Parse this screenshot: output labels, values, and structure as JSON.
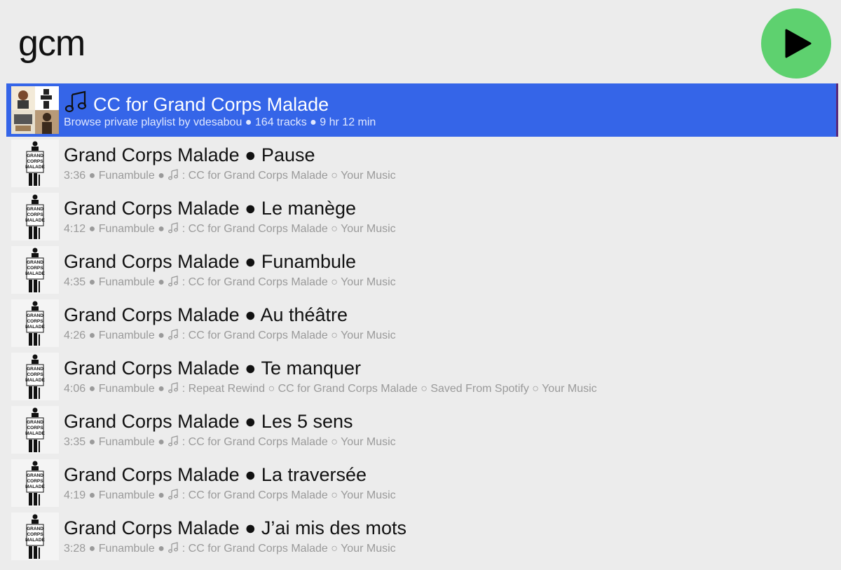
{
  "search": {
    "query": "gcm"
  },
  "controls": {
    "play_icon": "play-icon",
    "play_color": "#5ed16f",
    "selected_color": "#3565e8"
  },
  "results": [
    {
      "selected": true,
      "kind": "playlist",
      "title": "CC for Grand Corps Malade",
      "meta": "Browse private playlist by vdesabou ● 164 tracks ● 9 hr 12 min"
    },
    {
      "title": "Grand Corps Malade ● Pause",
      "meta_before": "3:36 ● Funambule ● ",
      "meta_after": " : CC for Grand Corps Malade ○ Your Music"
    },
    {
      "title": "Grand Corps Malade ● Le manège",
      "meta_before": "4:12 ● Funambule ● ",
      "meta_after": " : CC for Grand Corps Malade ○ Your Music"
    },
    {
      "title": "Grand Corps Malade ● Funambule",
      "meta_before": "4:35 ● Funambule ● ",
      "meta_after": " : CC for Grand Corps Malade ○ Your Music"
    },
    {
      "title": "Grand Corps Malade ● Au théâtre",
      "meta_before": "4:26 ● Funambule ● ",
      "meta_after": " : CC for Grand Corps Malade ○ Your Music"
    },
    {
      "title": "Grand Corps Malade ● Te manquer",
      "meta_before": "4:06 ● Funambule ● ",
      "meta_after": " : Repeat Rewind ○ CC for Grand Corps Malade ○ Saved From Spotify ○ Your Music"
    },
    {
      "title": "Grand Corps Malade ● Les 5 sens",
      "meta_before": "3:35 ● Funambule ● ",
      "meta_after": " : CC for Grand Corps Malade ○ Your Music"
    },
    {
      "title": "Grand Corps Malade ● La traversée",
      "meta_before": "4:19 ● Funambule ● ",
      "meta_after": " : CC for Grand Corps Malade ○ Your Music"
    },
    {
      "title": "Grand Corps Malade ● J’ai mis des mots",
      "meta_before": "3:28 ● Funambule ● ",
      "meta_after": " : CC for Grand Corps Malade ○ Your Music"
    }
  ]
}
